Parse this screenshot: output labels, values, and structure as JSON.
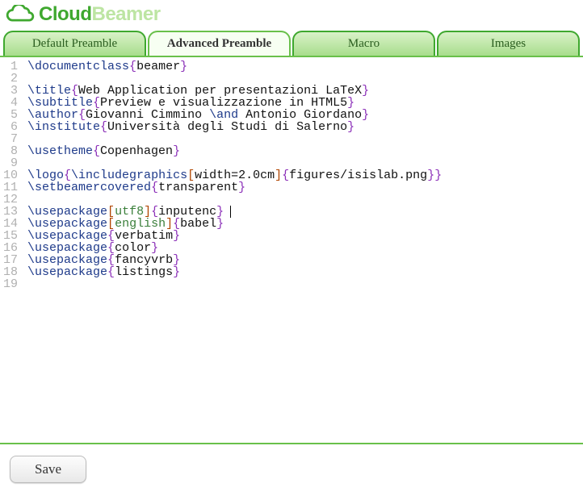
{
  "logo": {
    "part1": "Cloud",
    "part2": "Beamer"
  },
  "tabs": [
    {
      "label": "Default Preamble",
      "active": false
    },
    {
      "label": "Advanced Preamble",
      "active": true
    },
    {
      "label": "Macro",
      "active": false
    },
    {
      "label": "Images",
      "active": false
    }
  ],
  "code_lines": [
    [
      {
        "t": "cmd",
        "v": "\\documentclass"
      },
      {
        "t": "brace",
        "v": "{"
      },
      {
        "t": "txt",
        "v": "beamer"
      },
      {
        "t": "brace",
        "v": "}"
      }
    ],
    [],
    [
      {
        "t": "cmd",
        "v": "\\title"
      },
      {
        "t": "brace",
        "v": "{"
      },
      {
        "t": "txt",
        "v": "Web Application per presentazioni LaTeX"
      },
      {
        "t": "brace",
        "v": "}"
      }
    ],
    [
      {
        "t": "cmd",
        "v": "\\subtitle"
      },
      {
        "t": "brace",
        "v": "{"
      },
      {
        "t": "txt",
        "v": "Preview e visualizzazione in HTML5"
      },
      {
        "t": "brace",
        "v": "}"
      }
    ],
    [
      {
        "t": "cmd",
        "v": "\\author"
      },
      {
        "t": "brace",
        "v": "{"
      },
      {
        "t": "txt",
        "v": "Giovanni Cimmino "
      },
      {
        "t": "cmd",
        "v": "\\and"
      },
      {
        "t": "txt",
        "v": " Antonio Giordano"
      },
      {
        "t": "brace",
        "v": "}"
      }
    ],
    [
      {
        "t": "cmd",
        "v": "\\institute"
      },
      {
        "t": "brace",
        "v": "{"
      },
      {
        "t": "txt",
        "v": "Università degli Studi di Salerno"
      },
      {
        "t": "brace",
        "v": "}"
      }
    ],
    [],
    [
      {
        "t": "cmd",
        "v": "\\usetheme"
      },
      {
        "t": "brace",
        "v": "{"
      },
      {
        "t": "txt",
        "v": "Copenhagen"
      },
      {
        "t": "brace",
        "v": "}"
      }
    ],
    [],
    [
      {
        "t": "cmd",
        "v": "\\logo"
      },
      {
        "t": "brace",
        "v": "{"
      },
      {
        "t": "cmd",
        "v": "\\includegraphics"
      },
      {
        "t": "bracket",
        "v": "["
      },
      {
        "t": "txt",
        "v": "width=2.0cm"
      },
      {
        "t": "bracket",
        "v": "]"
      },
      {
        "t": "brace",
        "v": "{"
      },
      {
        "t": "txt",
        "v": "figures/isislab.png"
      },
      {
        "t": "brace",
        "v": "}"
      },
      {
        "t": "brace",
        "v": "}"
      }
    ],
    [
      {
        "t": "cmd",
        "v": "\\setbeamercovered"
      },
      {
        "t": "brace",
        "v": "{"
      },
      {
        "t": "txt",
        "v": "transparent"
      },
      {
        "t": "brace",
        "v": "}"
      }
    ],
    [],
    [
      {
        "t": "cmd",
        "v": "\\usepackage"
      },
      {
        "t": "bracket",
        "v": "["
      },
      {
        "t": "opt",
        "v": "utf8"
      },
      {
        "t": "bracket",
        "v": "]"
      },
      {
        "t": "brace",
        "v": "{"
      },
      {
        "t": "txt",
        "v": "inputenc"
      },
      {
        "t": "brace",
        "v": "}"
      }
    ],
    [
      {
        "t": "cmd",
        "v": "\\usepackage"
      },
      {
        "t": "bracket",
        "v": "["
      },
      {
        "t": "opt",
        "v": "english"
      },
      {
        "t": "bracket",
        "v": "]"
      },
      {
        "t": "brace",
        "v": "{"
      },
      {
        "t": "txt",
        "v": "babel"
      },
      {
        "t": "brace",
        "v": "}"
      }
    ],
    [
      {
        "t": "cmd",
        "v": "\\usepackage"
      },
      {
        "t": "brace",
        "v": "{"
      },
      {
        "t": "txt",
        "v": "verbatim"
      },
      {
        "t": "brace",
        "v": "}"
      }
    ],
    [
      {
        "t": "cmd",
        "v": "\\usepackage"
      },
      {
        "t": "brace",
        "v": "{"
      },
      {
        "t": "txt",
        "v": "color"
      },
      {
        "t": "brace",
        "v": "}"
      }
    ],
    [
      {
        "t": "cmd",
        "v": "\\usepackage"
      },
      {
        "t": "brace",
        "v": "{"
      },
      {
        "t": "txt",
        "v": "fancyvrb"
      },
      {
        "t": "brace",
        "v": "}"
      }
    ],
    [
      {
        "t": "cmd",
        "v": "\\usepackage"
      },
      {
        "t": "brace",
        "v": "{"
      },
      {
        "t": "txt",
        "v": "listings"
      },
      {
        "t": "brace",
        "v": "}"
      }
    ],
    []
  ],
  "cursor_line": 13,
  "save_label": "Save"
}
